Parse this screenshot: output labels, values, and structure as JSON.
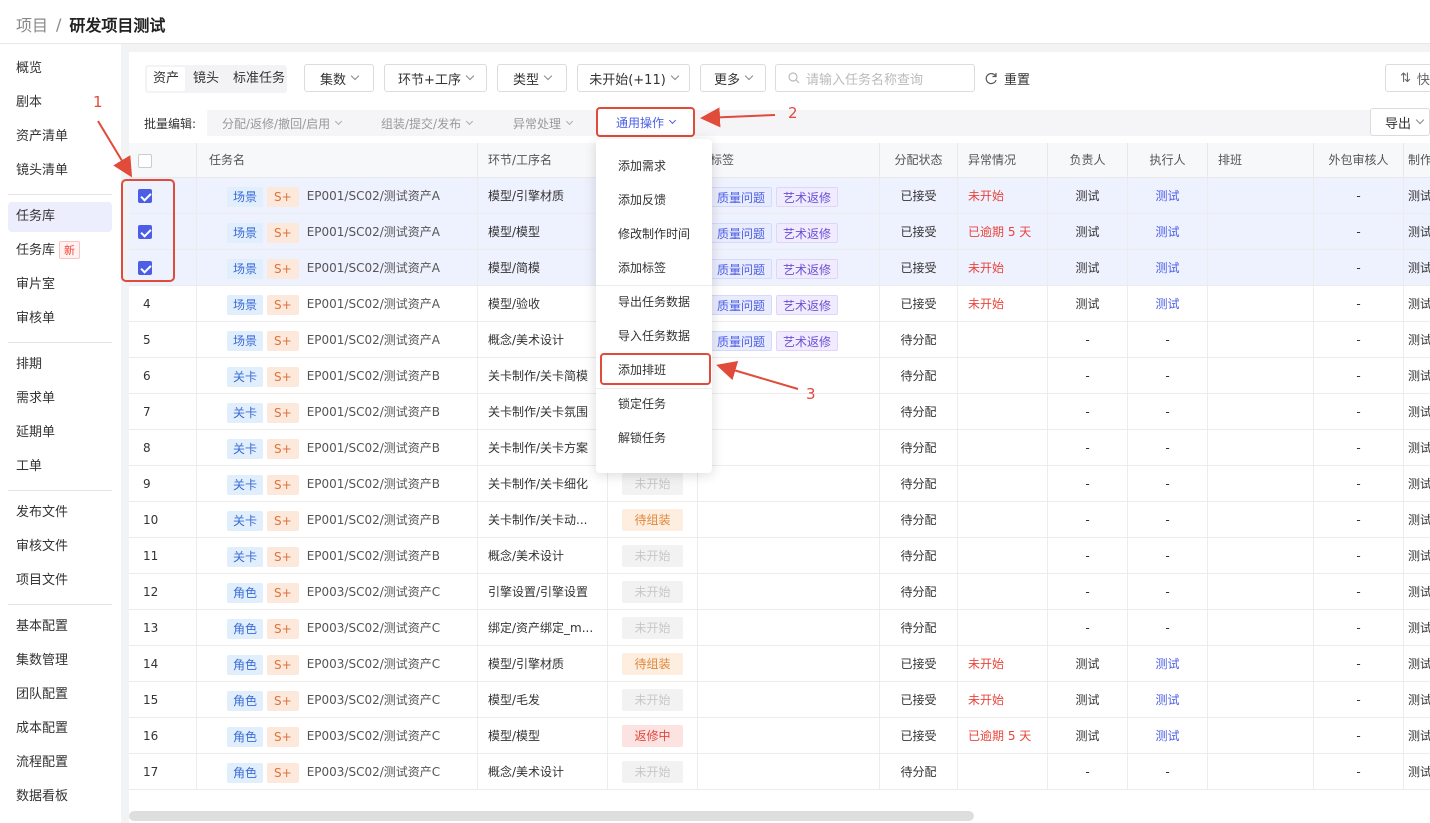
{
  "breadcrumb": {
    "root": "项目",
    "separator": "/",
    "current": "研发项目测试"
  },
  "sidebar": {
    "groups": [
      [
        {
          "label": "概览"
        },
        {
          "label": "剧本"
        },
        {
          "label": "资产清单"
        },
        {
          "label": "镜头清单"
        }
      ],
      [
        {
          "label": "任务库",
          "active": true
        },
        {
          "label": "任务库",
          "badge": "新"
        },
        {
          "label": "审片室"
        },
        {
          "label": "审核单"
        }
      ],
      [
        {
          "label": "排期"
        },
        {
          "label": "需求单"
        },
        {
          "label": "延期单"
        },
        {
          "label": "工单"
        }
      ],
      [
        {
          "label": "发布文件"
        },
        {
          "label": "审核文件"
        },
        {
          "label": "项目文件"
        }
      ],
      [
        {
          "label": "基本配置"
        },
        {
          "label": "集数管理"
        },
        {
          "label": "团队配置"
        },
        {
          "label": "成本配置"
        },
        {
          "label": "流程配置"
        },
        {
          "label": "数据看板"
        }
      ]
    ]
  },
  "toolbar": {
    "segments": [
      "资产",
      "镜头",
      "标准任务"
    ],
    "filters": [
      "集数",
      "环节+工序",
      "类型",
      "未开始(+11)",
      "更多"
    ],
    "search_placeholder": "请输入任务名称查询",
    "reset_label": "重置",
    "quick_label": "快"
  },
  "batch": {
    "label": "批量编辑:",
    "ops": [
      "分配/返修/撤回/启用",
      "组装/提交/发布",
      "异常处理"
    ],
    "general_op": "通用操作",
    "export_label": "导出"
  },
  "table": {
    "headers": [
      "任务名",
      "环节/工序名",
      "标签",
      "分配状态",
      "异常情况",
      "负责人",
      "执行人",
      "排班",
      "外包审核人",
      "制作"
    ],
    "rows": [
      {
        "no": "",
        "checked": true,
        "type": "场景",
        "grade": "S+",
        "path": "EP001/SC02/测试资产A",
        "step": "模型/引擎材质",
        "status": "",
        "tags": [
          "质量问题",
          "艺术返修"
        ],
        "assign": "已接受",
        "exc": "未开始",
        "owner": "测试",
        "exec": "测试",
        "outsource": "-",
        "maker": "测试"
      },
      {
        "no": "",
        "checked": true,
        "type": "场景",
        "grade": "S+",
        "path": "EP001/SC02/测试资产A",
        "step": "模型/模型",
        "status": "",
        "tags": [
          "质量问题",
          "艺术返修"
        ],
        "assign": "已接受",
        "exc": "已逾期 5 天",
        "owner": "测试",
        "exec": "测试",
        "outsource": "-",
        "maker": "测试"
      },
      {
        "no": "",
        "checked": true,
        "type": "场景",
        "grade": "S+",
        "path": "EP001/SC02/测试资产A",
        "step": "模型/简模",
        "status": "",
        "tags": [
          "质量问题",
          "艺术返修"
        ],
        "assign": "已接受",
        "exc": "未开始",
        "owner": "测试",
        "exec": "测试",
        "outsource": "-",
        "maker": "测试"
      },
      {
        "no": "4",
        "checked": false,
        "type": "场景",
        "grade": "S+",
        "path": "EP001/SC02/测试资产A",
        "step": "模型/验收",
        "status": "",
        "tags": [
          "质量问题",
          "艺术返修"
        ],
        "assign": "已接受",
        "exc": "未开始",
        "owner": "测试",
        "exec": "测试",
        "outsource": "-",
        "maker": "测试"
      },
      {
        "no": "5",
        "checked": false,
        "type": "场景",
        "grade": "S+",
        "path": "EP001/SC02/测试资产A",
        "step": "概念/美术设计",
        "status": "",
        "tags": [
          "质量问题",
          "艺术返修"
        ],
        "assign": "待分配",
        "exc": "",
        "owner": "-",
        "exec": "-",
        "outsource": "-",
        "maker": "测试"
      },
      {
        "no": "6",
        "checked": false,
        "type": "关卡",
        "grade": "S+",
        "path": "EP001/SC02/测试资产B",
        "step": "关卡制作/关卡简模",
        "status": "",
        "tags": [],
        "assign": "待分配",
        "exc": "",
        "owner": "-",
        "exec": "-",
        "outsource": "-",
        "maker": "测试"
      },
      {
        "no": "7",
        "checked": false,
        "type": "关卡",
        "grade": "S+",
        "path": "EP001/SC02/测试资产B",
        "step": "关卡制作/关卡氛围",
        "status": "",
        "tags": [],
        "assign": "待分配",
        "exc": "",
        "owner": "-",
        "exec": "-",
        "outsource": "-",
        "maker": "测试"
      },
      {
        "no": "8",
        "checked": false,
        "type": "关卡",
        "grade": "S+",
        "path": "EP001/SC02/测试资产B",
        "step": "关卡制作/关卡方案",
        "status": "",
        "tags": [],
        "assign": "待分配",
        "exc": "",
        "owner": "-",
        "exec": "-",
        "outsource": "-",
        "maker": "测试"
      },
      {
        "no": "9",
        "checked": false,
        "type": "关卡",
        "grade": "S+",
        "path": "EP001/SC02/测试资产B",
        "step": "关卡制作/关卡细化",
        "status": "未开始",
        "tags": [],
        "assign": "待分配",
        "exc": "",
        "owner": "-",
        "exec": "-",
        "outsource": "-",
        "maker": "测试"
      },
      {
        "no": "10",
        "checked": false,
        "type": "关卡",
        "grade": "S+",
        "path": "EP001/SC02/测试资产B",
        "step": "关卡制作/关卡动...",
        "status": "待组装",
        "tags": [],
        "assign": "待分配",
        "exc": "",
        "owner": "-",
        "exec": "-",
        "outsource": "-",
        "maker": "测试"
      },
      {
        "no": "11",
        "checked": false,
        "type": "关卡",
        "grade": "S+",
        "path": "EP001/SC02/测试资产B",
        "step": "概念/美术设计",
        "status": "未开始",
        "tags": [],
        "assign": "待分配",
        "exc": "",
        "owner": "-",
        "exec": "-",
        "outsource": "-",
        "maker": "测试"
      },
      {
        "no": "12",
        "checked": false,
        "type": "角色",
        "grade": "S+",
        "path": "EP003/SC02/测试资产C",
        "step": "引擎设置/引擎设置",
        "status": "未开始",
        "tags": [],
        "assign": "待分配",
        "exc": "",
        "owner": "-",
        "exec": "-",
        "outsource": "-",
        "maker": "测试"
      },
      {
        "no": "13",
        "checked": false,
        "type": "角色",
        "grade": "S+",
        "path": "EP003/SC02/测试资产C",
        "step": "绑定/资产绑定_m...",
        "status": "未开始",
        "tags": [],
        "assign": "待分配",
        "exc": "",
        "owner": "-",
        "exec": "-",
        "outsource": "-",
        "maker": "测试"
      },
      {
        "no": "14",
        "checked": false,
        "type": "角色",
        "grade": "S+",
        "path": "EP003/SC02/测试资产C",
        "step": "模型/引擎材质",
        "status": "待组装",
        "tags": [],
        "assign": "已接受",
        "exc": "未开始",
        "owner": "测试",
        "exec": "测试",
        "outsource": "-",
        "maker": "测试"
      },
      {
        "no": "15",
        "checked": false,
        "type": "角色",
        "grade": "S+",
        "path": "EP003/SC02/测试资产C",
        "step": "模型/毛发",
        "status": "未开始",
        "tags": [],
        "assign": "已接受",
        "exc": "未开始",
        "owner": "测试",
        "exec": "测试",
        "outsource": "-",
        "maker": "测试"
      },
      {
        "no": "16",
        "checked": false,
        "type": "角色",
        "grade": "S+",
        "path": "EP003/SC02/测试资产C",
        "step": "模型/模型",
        "status": "返修中",
        "tags": [],
        "assign": "已接受",
        "exc": "已逾期 5 天",
        "owner": "测试",
        "exec": "测试",
        "outsource": "-",
        "maker": "测试"
      },
      {
        "no": "17",
        "checked": false,
        "type": "角色",
        "grade": "S+",
        "path": "EP003/SC02/测试资产C",
        "step": "概念/美术设计",
        "status": "未开始",
        "tags": [],
        "assign": "待分配",
        "exc": "",
        "owner": "-",
        "exec": "-",
        "outsource": "-",
        "maker": "测试"
      }
    ]
  },
  "dropdown": {
    "items": [
      "添加需求",
      "添加反馈",
      "修改制作时间",
      "添加标签",
      "导出任务数据",
      "导入任务数据",
      "添加排班",
      "锁定任务",
      "解锁任务"
    ]
  },
  "annotations": {
    "one": "1",
    "two": "2",
    "three": "3"
  },
  "colors": {
    "accent": "#4b5ee5",
    "annotation": "#e04b3a",
    "danger": "#e8453c"
  }
}
